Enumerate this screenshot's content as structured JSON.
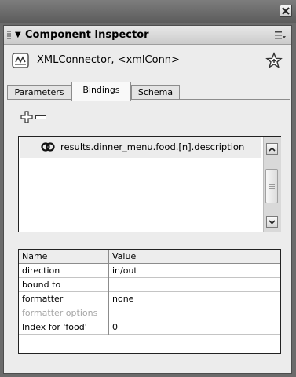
{
  "panel": {
    "title": "Component Inspector",
    "component_label": "XMLConnector, <xmlConn>"
  },
  "tabs": [
    {
      "label": "Parameters",
      "selected": false
    },
    {
      "label": "Bindings",
      "selected": true
    },
    {
      "label": "Schema",
      "selected": false
    }
  ],
  "bindings": {
    "items": [
      "results.dinner_menu.food.[n].description"
    ]
  },
  "props": {
    "header": {
      "name": "Name",
      "value": "Value"
    },
    "rows": [
      {
        "name": "direction",
        "value": "in/out"
      },
      {
        "name": "bound to",
        "value": ""
      },
      {
        "name": "formatter",
        "value": "none"
      },
      {
        "name": "formatter options",
        "value": ""
      },
      {
        "name": "Index for 'food'",
        "value": "0"
      }
    ]
  },
  "icons": {
    "close": "close-icon",
    "collapse": "collapse-triangle-icon",
    "options": "panel-options-icon",
    "component": "xml-connector-icon",
    "behaviors": "star-icon",
    "add": "plus-icon",
    "remove": "minus-icon",
    "binding": "binding-link-icon"
  },
  "colors": {
    "frame": "#6b6b6b",
    "panel_bg": "#ececec",
    "disabled_text": "#a6a6a6"
  }
}
